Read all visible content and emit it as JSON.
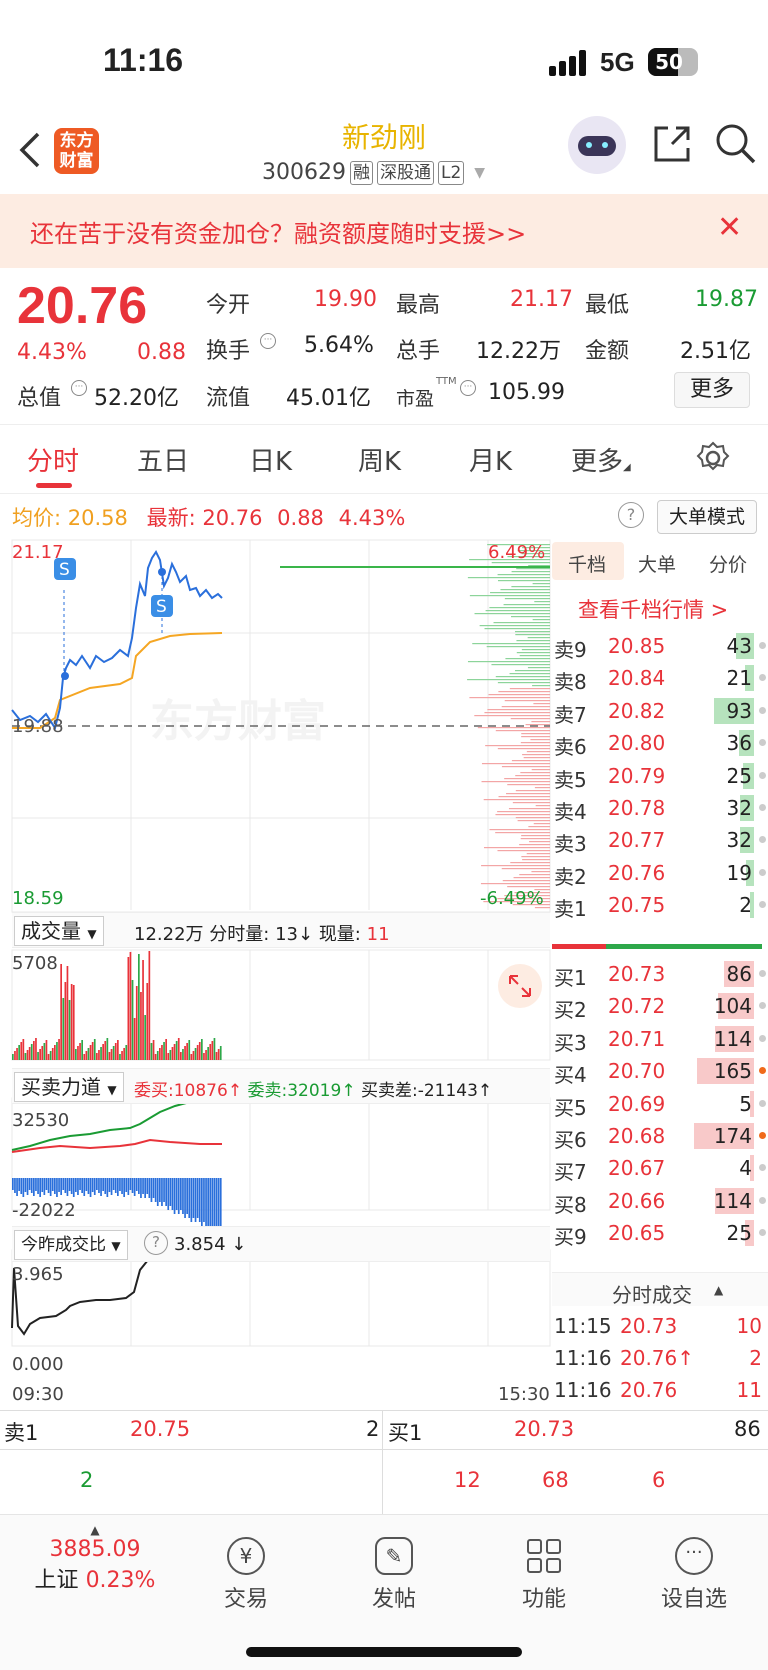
{
  "status_bar": {
    "time": "11:16",
    "network": "5G",
    "battery": "50"
  },
  "nav": {
    "logo_line1": "东方",
    "logo_line2": "财富",
    "stock_name": "新劲刚",
    "stock_code": "300629",
    "tags": [
      "融",
      "深股通",
      "L2"
    ]
  },
  "banner": {
    "text": "还在苦于没有资金加仓？融资额度随时支援>>"
  },
  "quote": {
    "price": "20.76",
    "change_pct": "4.43%",
    "change": "0.88",
    "open_label": "今开",
    "open": "19.90",
    "high_label": "最高",
    "high": "21.17",
    "low_label": "最低",
    "low": "19.87",
    "turnover_label": "换手",
    "turnover": "5.64%",
    "volume_label": "总手",
    "volume": "12.22万",
    "amount_label": "金额",
    "amount": "2.51亿",
    "mktcap_label": "总值",
    "mktcap": "52.20亿",
    "float_label": "流值",
    "float": "45.01亿",
    "pe_label": "市盈",
    "pe_sup": "TTM",
    "pe": "105.99",
    "more_label": "更多"
  },
  "tabs": [
    "分时",
    "五日",
    "日K",
    "周K",
    "月K",
    "更多"
  ],
  "info_line": {
    "avg_label": "均价:",
    "avg": "20.58",
    "latest_label": "最新:",
    "latest": "20.76",
    "change": "0.88",
    "pct": "4.43%",
    "mode_button": "大单模式"
  },
  "chart": {
    "price_top": "21.17",
    "price_bottom": "18.59",
    "prev_close": "19.88",
    "pct_top": "6.49%",
    "pct_bottom": "-6.49%",
    "marker_label": "S",
    "watermark": "东方财富",
    "time_start": "09:30",
    "time_end": "15:30"
  },
  "volume_panel": {
    "dropdown": "成交量",
    "total": "12.22万",
    "min_vol_label": "分时量:",
    "min_vol": "13",
    "cur_vol_label": "现量:",
    "cur_vol": "11",
    "max": "5708"
  },
  "force_panel": {
    "dropdown": "买卖力道",
    "buy_label": "委买:",
    "buy": "10876",
    "sell_label": "委卖:",
    "sell": "32019",
    "diff_label": "买卖差:",
    "diff": "-21143",
    "top": "32530",
    "bottom": "-22022"
  },
  "ratio_panel": {
    "dropdown": "今昨成交比",
    "value": "3.854",
    "top": "3.965",
    "bottom": "0.000"
  },
  "orderbook": {
    "tabs": [
      "千档",
      "大单",
      "分价"
    ],
    "link": "查看千档行情 >",
    "asks": [
      {
        "label": "卖9",
        "price": "20.85",
        "vol": "43"
      },
      {
        "label": "卖8",
        "price": "20.84",
        "vol": "21"
      },
      {
        "label": "卖7",
        "price": "20.82",
        "vol": "93"
      },
      {
        "label": "卖6",
        "price": "20.80",
        "vol": "36"
      },
      {
        "label": "卖5",
        "price": "20.79",
        "vol": "25"
      },
      {
        "label": "卖4",
        "price": "20.78",
        "vol": "32"
      },
      {
        "label": "卖3",
        "price": "20.77",
        "vol": "32"
      },
      {
        "label": "卖2",
        "price": "20.76",
        "vol": "19"
      },
      {
        "label": "卖1",
        "price": "20.75",
        "vol": "2"
      }
    ],
    "bids": [
      {
        "label": "买1",
        "price": "20.73",
        "vol": "86"
      },
      {
        "label": "买2",
        "price": "20.72",
        "vol": "104"
      },
      {
        "label": "买3",
        "price": "20.71",
        "vol": "114"
      },
      {
        "label": "买4",
        "price": "20.70",
        "vol": "165"
      },
      {
        "label": "买5",
        "price": "20.69",
        "vol": "5"
      },
      {
        "label": "买6",
        "price": "20.68",
        "vol": "174"
      },
      {
        "label": "买7",
        "price": "20.67",
        "vol": "4"
      },
      {
        "label": "买8",
        "price": "20.66",
        "vol": "114"
      },
      {
        "label": "买9",
        "price": "20.65",
        "vol": "25"
      }
    ],
    "trades_header": "分时成交",
    "trades": [
      {
        "time": "11:15",
        "price": "20.73",
        "vol": "10"
      },
      {
        "time": "11:16",
        "price": "20.76↑",
        "vol": "2"
      },
      {
        "time": "11:16",
        "price": "20.76",
        "vol": "11"
      }
    ]
  },
  "bottom_quote": {
    "ask_label": "卖1",
    "ask_price": "20.75",
    "ask_vol": "2",
    "bid_label": "买1",
    "bid_price": "20.73",
    "bid_vol": "86",
    "row2": [
      "2",
      "12",
      "68",
      "6"
    ]
  },
  "tabbar": {
    "index_value": "3885.09",
    "index_name": "上证",
    "index_pct": "0.23%",
    "items": [
      "交易",
      "发帖",
      "功能",
      "设自选"
    ]
  }
}
